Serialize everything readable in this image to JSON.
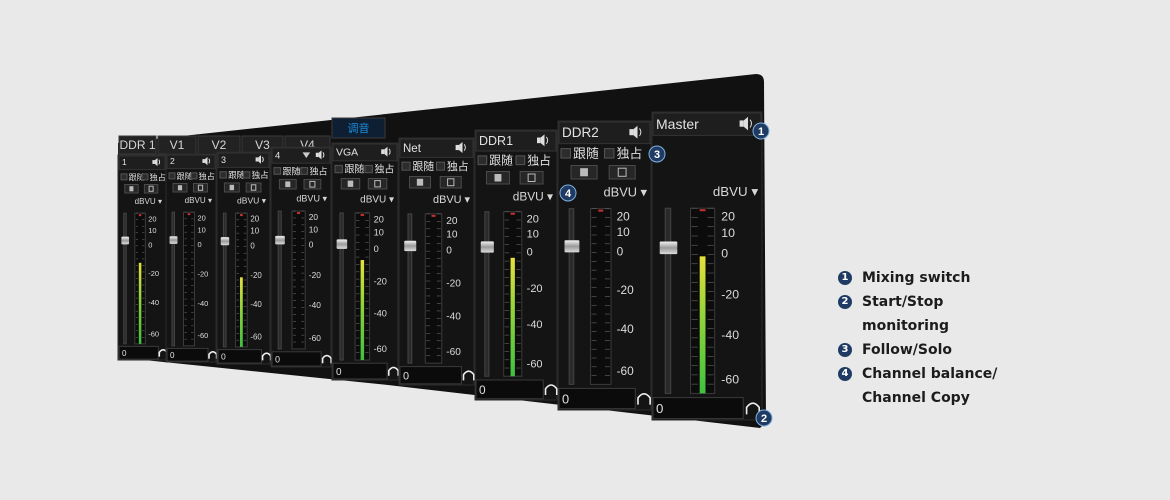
{
  "tabs": [
    "DDR 1",
    "V1",
    "V2",
    "V3",
    "V4",
    "调音"
  ],
  "active_tab_index": 5,
  "colors": {
    "panel": "#141414",
    "accent_blue": "#1c8fe0",
    "meter_green": "#3fc23f",
    "meter_yellow": "#e6e03c",
    "callout_badge": "#1f3b63"
  },
  "channels": [
    {
      "label": "1",
      "follow_label": "跟随",
      "solo_label": "独占",
      "unit_label": "dBVU",
      "value": "0",
      "level": 0.62
    },
    {
      "label": "2",
      "follow_label": "跟随",
      "solo_label": "独占",
      "unit_label": "dBVU",
      "value": "0",
      "level": 0.0
    },
    {
      "label": "3",
      "follow_label": "跟随",
      "solo_label": "独占",
      "unit_label": "dBVU",
      "value": "0",
      "level": 0.52
    },
    {
      "label": "4",
      "follow_label": "跟随",
      "solo_label": "独占",
      "unit_label": "dBVU",
      "value": "0",
      "level": 0.0
    },
    {
      "label": "VGA",
      "follow_label": "跟随",
      "solo_label": "独占",
      "unit_label": "dBVU",
      "value": "0",
      "level": 0.68
    },
    {
      "label": "Net",
      "follow_label": "跟随",
      "solo_label": "独占",
      "unit_label": "dBVU",
      "value": "0",
      "level": 0.0
    },
    {
      "label": "DDR1",
      "follow_label": "跟随",
      "solo_label": "独占",
      "unit_label": "dBVU",
      "value": "0",
      "level": 0.72
    },
    {
      "label": "DDR2",
      "follow_label": "跟随",
      "solo_label": "独占",
      "unit_label": "dBVU",
      "value": "0",
      "level": 0.0
    },
    {
      "label": "Master",
      "unit_label": "dBVU",
      "value": "0",
      "level": 0.74
    }
  ],
  "scale_labels": [
    "20",
    "10",
    "0",
    "-20",
    "-40",
    "-60"
  ],
  "callouts": [
    "1",
    "2",
    "3",
    "4"
  ],
  "legend": [
    {
      "num": "1",
      "text": "Mixing switch"
    },
    {
      "num": "2",
      "text": "Start/Stop\nmonitoring"
    },
    {
      "num": "3",
      "text": "Follow/Solo"
    },
    {
      "num": "4",
      "text": "Channel balance/\nChannel Copy"
    }
  ]
}
